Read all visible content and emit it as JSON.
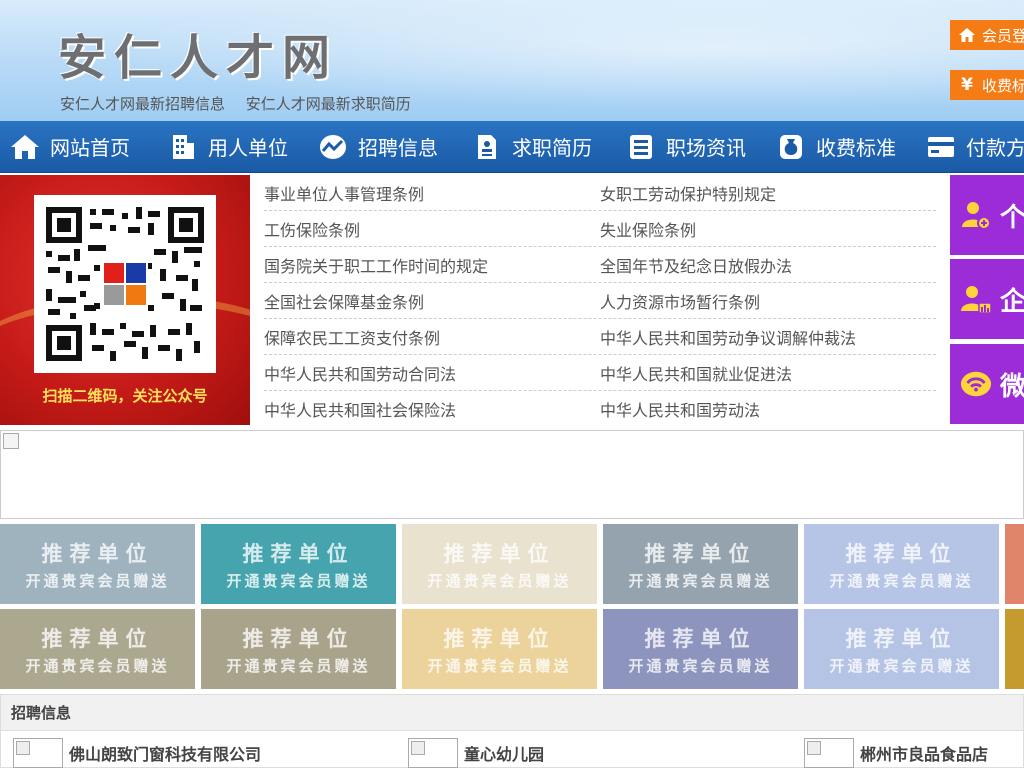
{
  "header": {
    "site_title": "安仁人才网",
    "links": [
      "安仁人才网最新招聘信息",
      "安仁人才网最新求职简历"
    ],
    "login_button": "会员登",
    "fee_button": "收费标"
  },
  "nav": {
    "items": [
      {
        "label": "网站首页",
        "icon": "home-icon"
      },
      {
        "label": "用人单位",
        "icon": "building-icon"
      },
      {
        "label": "招聘信息",
        "icon": "chart-icon"
      },
      {
        "label": "求职简历",
        "icon": "resume-icon"
      },
      {
        "label": "职场资讯",
        "icon": "news-icon"
      },
      {
        "label": "收费标准",
        "icon": "money-bag-icon"
      },
      {
        "label": "付款方式",
        "icon": "card-icon"
      }
    ]
  },
  "qr": {
    "caption": "扫描二维码，关注公众号"
  },
  "laws": [
    [
      "事业单位人事管理条例",
      "女职工劳动保护特别规定"
    ],
    [
      "工伤保险条例",
      "失业保险条例"
    ],
    [
      "国务院关于职工工作时间的规定",
      "全国年节及纪念日放假办法"
    ],
    [
      "全国社会保障基金条例",
      "人力资源市场暂行条例"
    ],
    [
      "保障农民工工资支付条例",
      "中华人民共和国劳动争议调解仲裁法"
    ],
    [
      "中华人民共和国劳动合同法",
      "中华人民共和国就业促进法"
    ],
    [
      "中华人民共和国社会保险法",
      "中华人民共和国劳动法"
    ]
  ],
  "side_tiles": [
    {
      "label": "个",
      "icon": "user-add-icon"
    },
    {
      "label": "企",
      "icon": "user-chart-icon"
    },
    {
      "label": "微",
      "icon": "wechat-icon"
    }
  ],
  "recommend": {
    "title": "推荐单位",
    "subtitle": "开通贵宾会员赠送",
    "colors_row1": [
      "#9fb3bf",
      "#45a4ae",
      "#e8e2cf",
      "#95a3ae",
      "#b6c5e6",
      "#e0856a"
    ],
    "colors_row2": [
      "#aca78f",
      "#a9a38b",
      "#ecd39b",
      "#8d94be",
      "#b5c3e4",
      "#c59a2e"
    ]
  },
  "jobs": {
    "heading": "招聘信息",
    "companies": [
      "佛山朗致门窗科技有限公司",
      "童心幼儿园",
      "郴州市良品食品店"
    ]
  }
}
